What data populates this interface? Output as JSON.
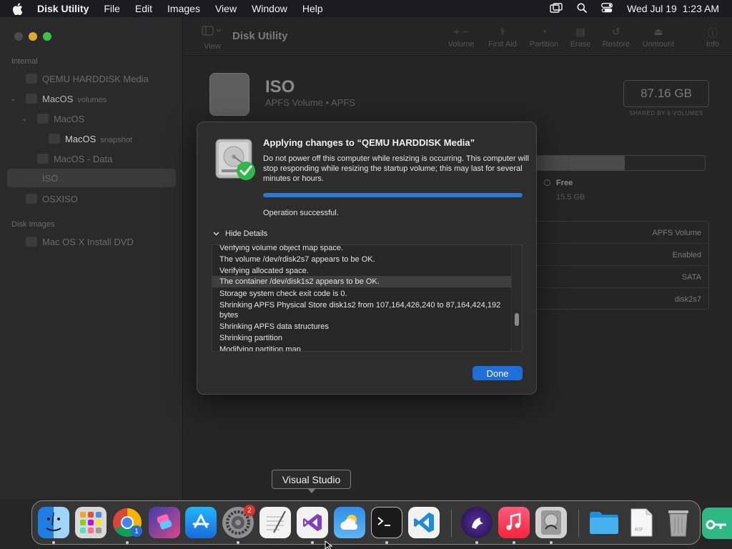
{
  "menubar": {
    "app_name": "Disk Utility",
    "items": [
      "File",
      "Edit",
      "Images",
      "View",
      "Window",
      "Help"
    ],
    "clock": "Wed Jul 19  1:23 AM",
    "icons": [
      "apple-icon",
      "screen-mirroring-icon",
      "search-icon",
      "control-center-icon"
    ]
  },
  "sidebar": {
    "section_internal": "Internal",
    "items": [
      {
        "label": "QEMU HARDDISK Media",
        "sub": ""
      },
      {
        "label": "MacOS",
        "sub": "volumes"
      },
      {
        "label": "MacOS",
        "sub": ""
      },
      {
        "label": "MacOS",
        "sub": "snapshot"
      },
      {
        "label": "MacOS - Data",
        "sub": ""
      },
      {
        "label": "ISO",
        "sub": ""
      },
      {
        "label": "OSXISO",
        "sub": ""
      }
    ],
    "section_images": "Disk Images",
    "image_items": [
      {
        "label": "Mac OS X Install DVD"
      }
    ]
  },
  "toolbar": {
    "view_label": "View",
    "title": "Disk Utility",
    "buttons": [
      "Volume",
      "First Aid",
      "Partition",
      "Erase",
      "Restore",
      "Unmount",
      "Info"
    ]
  },
  "volume": {
    "name": "ISO",
    "subtitle": "APFS Volume • APFS",
    "size": "87.16 GB",
    "size_caption": "SHARED BY 6 VOLUMES",
    "used_fraction": 0.55,
    "free_label": "Free",
    "free_value": "15.5 GB",
    "info_values": [
      "APFS Volume",
      "Enabled",
      "SATA",
      "disk2s7"
    ]
  },
  "dialog": {
    "title": "Applying changes to “QEMU HARDDISK Media”",
    "message": "Do not power off this computer while resizing is occurring. This computer will stop responding while resizing the startup volume; this may last for several minutes or hours.",
    "progress_fraction": 1.0,
    "status": "Operation successful.",
    "details_toggle": "Hide Details",
    "log": [
      "Verifying volume object map space.",
      "The volume /dev/rdisk2s7 appears to be OK.",
      "Verifying allocated space.",
      "The container /dev/disk1s2 appears to be OK.",
      "Storage system check exit code is 0.",
      "Shrinking APFS Physical Store disk1s2 from 107,164,426,240 to 87,164,424,192 bytes",
      "Shrinking APFS data structures",
      "Shrinking partition",
      "Modifying partition map"
    ],
    "selected_log_index": 3,
    "done_label": "Done",
    "accent": "#1e6fd9"
  },
  "dock": {
    "tooltip": "Visual Studio",
    "chrome_badge": "1",
    "settings_badge": "2",
    "rtf_label": "RTF",
    "apps": [
      "finder-icon",
      "launchpad-icon",
      "chrome-icon",
      "shortcuts-icon",
      "app-store-icon",
      "system-settings-icon",
      "textedit-icon",
      "visual-studio-icon",
      "weather-icon",
      "terminal-icon",
      "vscode-icon",
      "mastodon-icon",
      "music-icon",
      "disk-utility-icon",
      "folder-icon",
      "rtf-document-icon",
      "trash-icon"
    ]
  }
}
